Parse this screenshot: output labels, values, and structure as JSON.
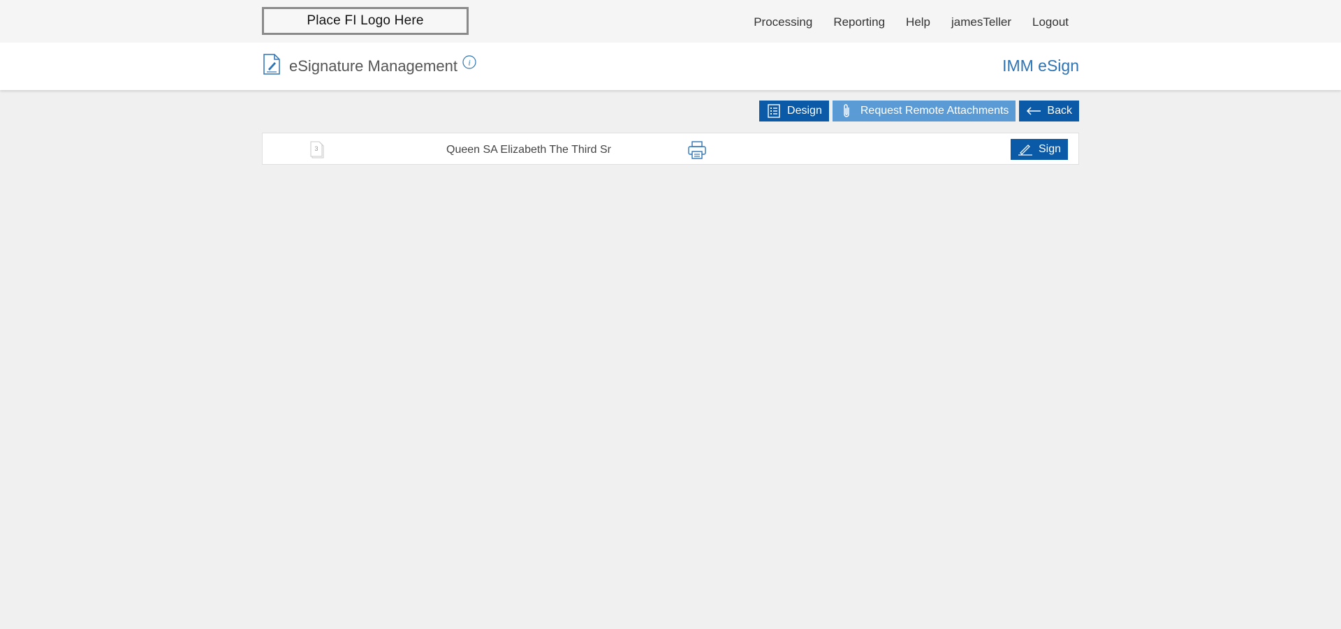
{
  "topbar": {
    "logo_text": "Place FI Logo Here",
    "nav": [
      {
        "label": "Processing"
      },
      {
        "label": "Reporting"
      },
      {
        "label": "Help"
      },
      {
        "label": "jamesTeller"
      },
      {
        "label": "Logout"
      }
    ]
  },
  "header": {
    "page_title": "eSignature Management",
    "page_icon": "document-sign-icon",
    "info_icon": "info-icon",
    "app_name": "IMM eSign"
  },
  "toolbar": {
    "design_label": "Design",
    "design_icon": "checklist-icon",
    "attachments_label": "Request Remote Attachments",
    "attachments_icon": "paperclip-icon",
    "back_label": "Back",
    "back_icon": "arrow-left-icon"
  },
  "document": {
    "page_count": "3",
    "name": "Queen SA Elizabeth The Third Sr",
    "print_icon": "printer-icon",
    "sign_label": "Sign",
    "sign_icon": "pen-icon"
  },
  "colors": {
    "primary": "#0a5aa8",
    "primary_light": "#5b9bd5",
    "app_name": "#2e74b5",
    "background": "#f0f0f0"
  }
}
